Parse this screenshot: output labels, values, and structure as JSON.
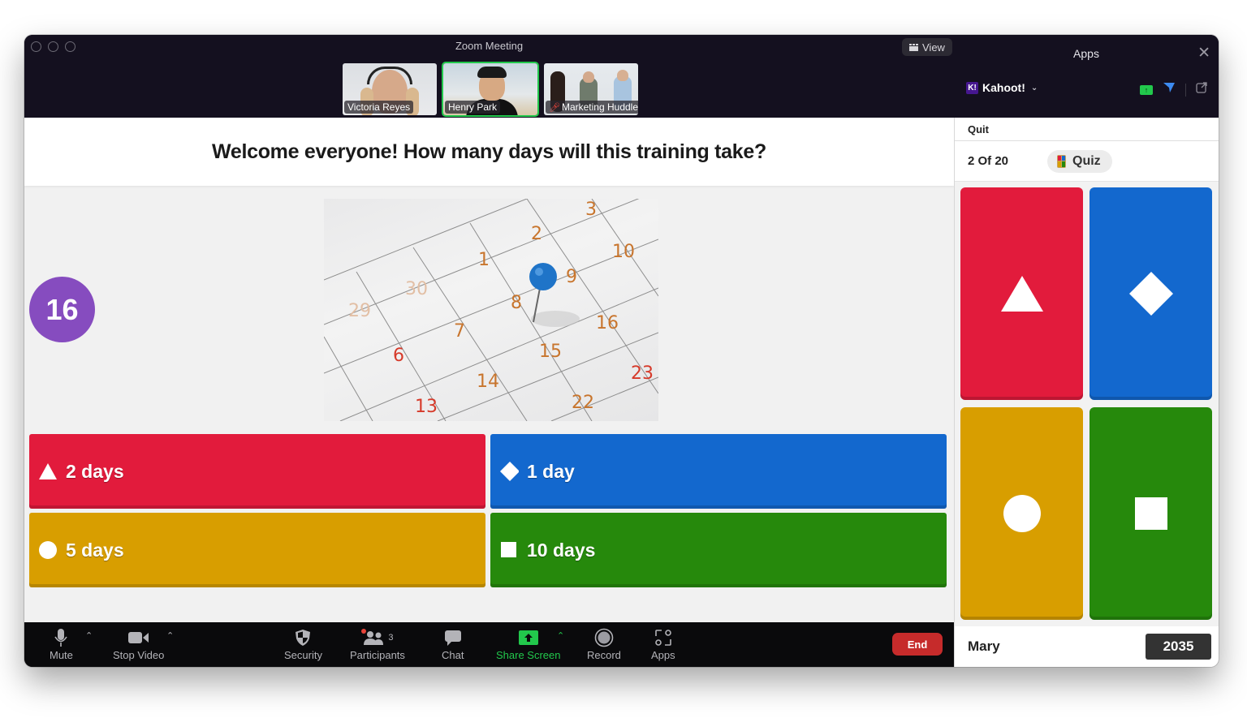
{
  "window": {
    "title": "Zoom Meeting",
    "view_label": "View"
  },
  "participants_strip": [
    {
      "name": "Victoria Reyes",
      "active": false,
      "muted": false
    },
    {
      "name": "Henry Park",
      "active": true,
      "muted": false
    },
    {
      "name": "Marketing Huddle",
      "active": false,
      "muted": true
    }
  ],
  "quiz": {
    "question": "Welcome everyone! How many days will this training take?",
    "timer": "16",
    "image_description": "calendar-with-blue-pushpin",
    "answers": [
      {
        "shape": "triangle",
        "label": "2 days",
        "color": "#e21b3c"
      },
      {
        "shape": "diamond",
        "label": "1 day",
        "color": "#1368ce"
      },
      {
        "shape": "circle",
        "label": "5 days",
        "color": "#d89e00"
      },
      {
        "shape": "square",
        "label": "10 days",
        "color": "#26890c"
      }
    ]
  },
  "toolbar": {
    "mute": "Mute",
    "stop_video": "Stop Video",
    "security": "Security",
    "participants": "Participants",
    "participants_count": "3",
    "chat": "Chat",
    "share_screen": "Share Screen",
    "record": "Record",
    "apps": "Apps",
    "end": "End"
  },
  "apps_panel": {
    "title": "Apps",
    "app_name": "Kahoot!",
    "app_logo": "K!",
    "quit": "Quit",
    "progress": "2 Of 20",
    "mode": "Quiz",
    "player_name": "Mary",
    "player_score": "2035"
  },
  "colors": {
    "kahoot_purple": "#864cbf",
    "share_green": "#22c84c",
    "end_red": "#c62b2b"
  }
}
